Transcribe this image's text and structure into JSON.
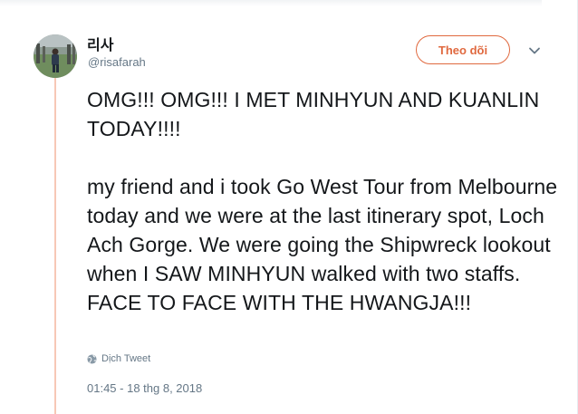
{
  "tweet": {
    "author_name": "리사",
    "author_handle": "@risafarah",
    "follow_label": "Theo dõi",
    "text": "OMG!!! OMG!!! I MET MINHYUN AND KUANLIN TODAY!!!!\n\nmy friend and i took Go West Tour from Melbourne today and we were at the last itinerary spot, Loch Ach Gorge. We were going the Shipwreck lookout when I SAW MINHYUN walked with two staffs. FACE TO FACE WITH THE HWANGJA!!!",
    "translate_label": "Dịch Tweet",
    "timestamp": "01:45 - 18 thg 8, 2018"
  },
  "icons": {
    "more": "chevron-down-icon",
    "translate": "globe-icon"
  },
  "colors": {
    "accent": "#e0693f",
    "thread": "#f7c8b6",
    "text": "#14171a",
    "secondary": "#657786"
  }
}
